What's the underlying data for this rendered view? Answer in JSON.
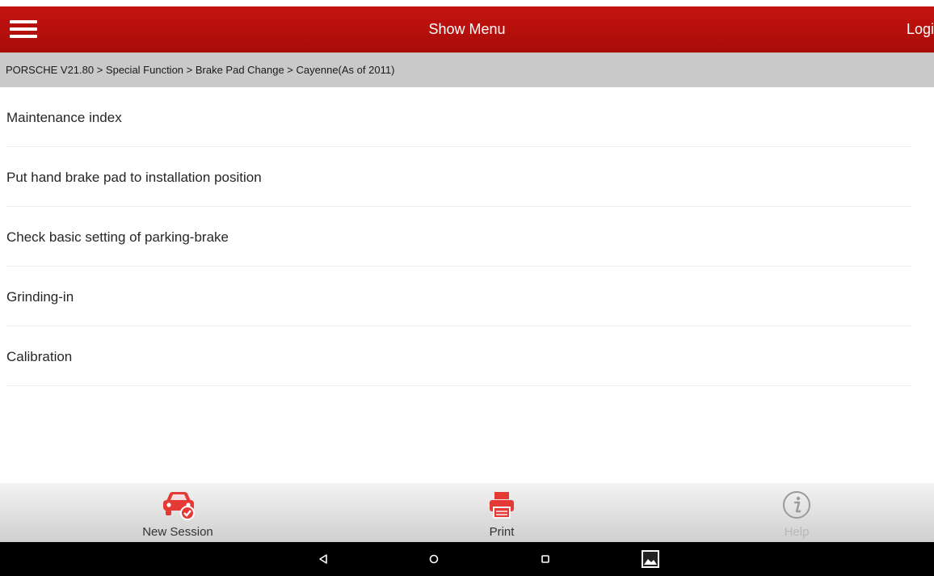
{
  "header": {
    "menu_icon": "hamburger-menu-icon",
    "title": "Show Menu",
    "login_label": "Login",
    "color": "#b5100c"
  },
  "breadcrumb": "PORSCHE V21.80 > Special Function > Brake Pad Change > Cayenne(As of 2011)",
  "menu": {
    "items": [
      {
        "label": "Maintenance index"
      },
      {
        "label": "Put hand brake pad to installation position"
      },
      {
        "label": "Check basic setting of parking-brake"
      },
      {
        "label": "Grinding-in"
      },
      {
        "label": "Calibration"
      }
    ]
  },
  "toolbar": {
    "new_session": {
      "label": "New Session",
      "icon": "car-check-icon",
      "color": "#e53935"
    },
    "print": {
      "label": "Print",
      "icon": "printer-icon",
      "color": "#e53935"
    },
    "help": {
      "label": "Help",
      "icon": "info-icon",
      "color": "#b8b8b8"
    }
  },
  "navbar": {
    "back_icon": "back-triangle-icon",
    "home_icon": "home-circle-icon",
    "recents_icon": "recents-square-icon",
    "screenshot_icon": "screenshot-gallery-icon"
  }
}
